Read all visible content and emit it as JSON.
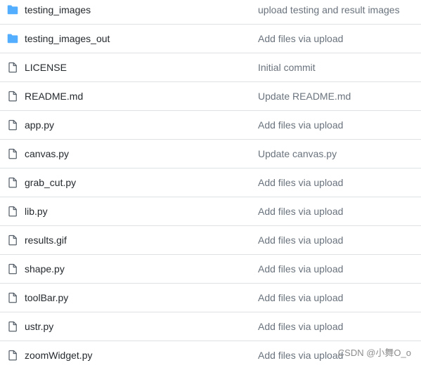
{
  "colors": {
    "folder_icon": "#54aeff",
    "file_icon": "#57606a",
    "file_name": "#24292e",
    "commit_message": "#6a737d",
    "row_border": "#dfe2e5"
  },
  "files": [
    {
      "name": "testing_images",
      "type": "folder",
      "icon": "folder-icon",
      "commit": "upload testing and result images"
    },
    {
      "name": "testing_images_out",
      "type": "folder",
      "icon": "folder-icon",
      "commit": "Add files via upload"
    },
    {
      "name": "LICENSE",
      "type": "file",
      "icon": "file-icon",
      "commit": "Initial commit"
    },
    {
      "name": "README.md",
      "type": "file",
      "icon": "file-icon",
      "commit": "Update README.md"
    },
    {
      "name": "app.py",
      "type": "file",
      "icon": "file-icon",
      "commit": "Add files via upload"
    },
    {
      "name": "canvas.py",
      "type": "file",
      "icon": "file-icon",
      "commit": "Update canvas.py"
    },
    {
      "name": "grab_cut.py",
      "type": "file",
      "icon": "file-icon",
      "commit": "Add files via upload"
    },
    {
      "name": "lib.py",
      "type": "file",
      "icon": "file-icon",
      "commit": "Add files via upload"
    },
    {
      "name": "results.gif",
      "type": "file",
      "icon": "file-icon",
      "commit": "Add files via upload"
    },
    {
      "name": "shape.py",
      "type": "file",
      "icon": "file-icon",
      "commit": "Add files via upload"
    },
    {
      "name": "toolBar.py",
      "type": "file",
      "icon": "file-icon",
      "commit": "Add files via upload"
    },
    {
      "name": "ustr.py",
      "type": "file",
      "icon": "file-icon",
      "commit": "Add files via upload"
    },
    {
      "name": "zoomWidget.py",
      "type": "file",
      "icon": "file-icon",
      "commit": "Add files via upload"
    }
  ],
  "watermark": "CSDN @小舞O_o"
}
